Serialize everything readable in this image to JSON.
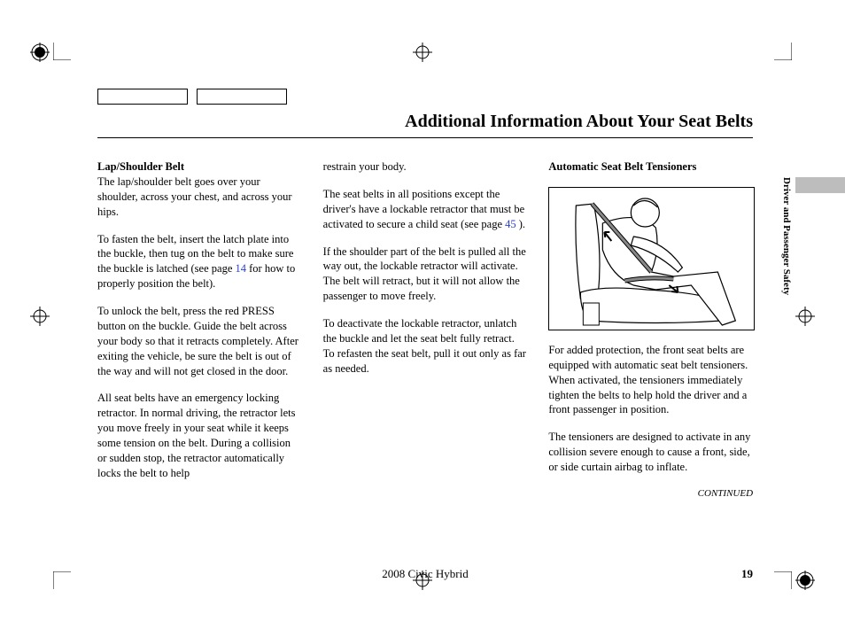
{
  "page_title": "Additional Information About Your Seat Belts",
  "section_tab": "Driver and Passenger Safety",
  "col1": {
    "subhead": "Lap/Shoulder Belt",
    "p1": "The lap/shoulder belt goes over your shoulder, across your chest, and across your hips.",
    "p2a": "To fasten the belt, insert the latch plate into the buckle, then tug on the belt to make sure the buckle is latched (see page ",
    "p2_link": "14",
    "p2b": " for how to properly position the belt).",
    "p3": "To unlock the belt, press the red PRESS button on the buckle. Guide the belt across your body so that it retracts completely. After exiting the vehicle, be sure the belt is out of the way and will not get closed in the door.",
    "p4": "All seat belts have an emergency locking retractor. In normal driving, the retractor lets you move freely in your seat while it keeps some tension on the belt. During a collision or sudden stop, the retractor automatically locks the belt to help"
  },
  "col2": {
    "p1": "restrain your body.",
    "p2a": "The seat belts in all positions except the driver's have a lockable retractor that must be activated to secure a child seat (see page ",
    "p2_link": "45",
    "p2b": " ).",
    "p3": "If the shoulder part of the belt is pulled all the way out, the lockable retractor will activate. The belt will retract, but it will not allow the passenger to move freely.",
    "p4": "To deactivate the lockable retractor, unlatch the buckle and let the seat belt fully retract. To refasten the seat belt, pull it out only as far as needed."
  },
  "col3": {
    "subhead": "Automatic Seat Belt Tensioners",
    "p1": "For added protection, the front seat belts are equipped with automatic seat belt tensioners. When activated, the tensioners immediately tighten the belts to help hold the driver and a front passenger in position.",
    "p2": "The tensioners are designed to activate in any collision severe enough to cause a front, side, or side curtain airbag to inflate.",
    "continued": "CONTINUED"
  },
  "footer": {
    "center": "2008  Civic  Hybrid",
    "pagenum": "19"
  }
}
